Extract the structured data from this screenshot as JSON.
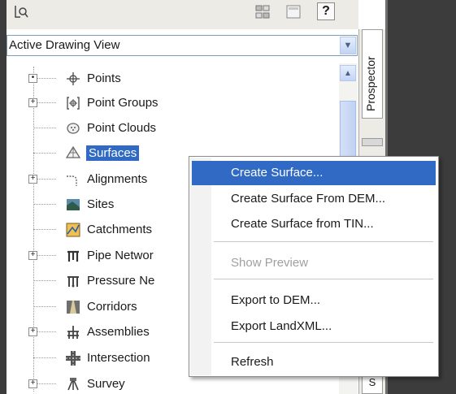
{
  "toolbar": {
    "icons": [
      "ql-icon",
      "item-view-icon",
      "panel-icon"
    ],
    "help_label": "?"
  },
  "view_selector": {
    "value": "Active Drawing View"
  },
  "side_tabs": {
    "prospector": "Prospector",
    "bottom_tab": "S"
  },
  "tree": {
    "items": [
      {
        "label": "Points",
        "icon": "points-icon",
        "expander": "dot"
      },
      {
        "label": "Point Groups",
        "icon": "point-groups-icon",
        "expander": "plus"
      },
      {
        "label": "Point Clouds",
        "icon": "point-clouds-icon",
        "expander": "none"
      },
      {
        "label": "Surfaces",
        "icon": "surfaces-icon",
        "expander": "none",
        "selected": true
      },
      {
        "label": "Alignments",
        "icon": "alignments-icon",
        "expander": "plus"
      },
      {
        "label": "Sites",
        "icon": "sites-icon",
        "expander": "none"
      },
      {
        "label": "Catchments",
        "icon": "catchments-icon",
        "expander": "none"
      },
      {
        "label": "Pipe Networ",
        "icon": "pipe-networks-icon",
        "expander": "plus"
      },
      {
        "label": "Pressure Ne",
        "icon": "pressure-networks-icon",
        "expander": "none"
      },
      {
        "label": "Corridors",
        "icon": "corridors-icon",
        "expander": "none"
      },
      {
        "label": "Assemblies",
        "icon": "assemblies-icon",
        "expander": "plus"
      },
      {
        "label": "Intersection",
        "icon": "intersections-icon",
        "expander": "none"
      },
      {
        "label": "Survey",
        "icon": "survey-icon",
        "expander": "plus"
      }
    ]
  },
  "context_menu": {
    "items": [
      {
        "label": "Create Surface...",
        "highlight": true
      },
      {
        "label": "Create Surface From DEM..."
      },
      {
        "label": "Create Surface from TIN..."
      },
      {
        "label": "Show Preview",
        "disabled": true
      },
      {
        "label": "Export to DEM..."
      },
      {
        "label": "Export LandXML..."
      },
      {
        "label": "Refresh"
      }
    ]
  },
  "colors": {
    "selection": "#316ac5",
    "frame": "#3c3c3c",
    "panel": "#ecebe6"
  }
}
